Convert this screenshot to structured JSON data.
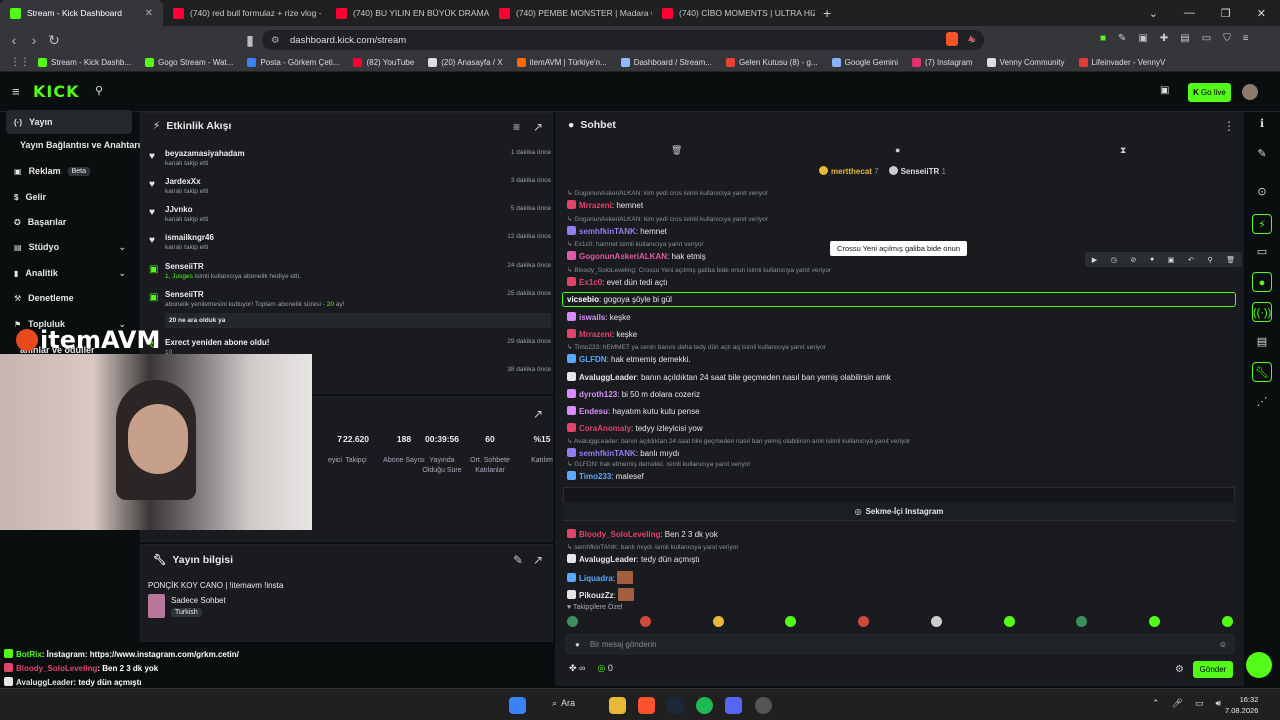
{
  "browser": {
    "tabs": [
      {
        "label": "Stream - Kick Dashboard",
        "color": "#53fc18",
        "active": true
      },
      {
        "label": "(740) red bull formulaz + rize vlog -",
        "color": "#ff0033",
        "active": false
      },
      {
        "label": "(740) BU YILIN EN BÜYÜK DRAMASI",
        "color": "#ff0033",
        "active": false
      },
      {
        "label": "(740) PEMBE MONSTER | Madara Ol",
        "color": "#ff0033",
        "active": false
      },
      {
        "label": "(740) CİBO MOMENTS | ULTRA HIZL",
        "color": "#ff0033",
        "active": false
      }
    ],
    "url": "dashboard.kick.com/stream",
    "bookmarks": [
      {
        "label": "Stream - Kick Dashb...",
        "color": "#53fc18"
      },
      {
        "label": "Gogo Stream - Wat...",
        "color": "#53fc18"
      },
      {
        "label": "Posta - Görkem Çeti...",
        "color": "#3b82f6"
      },
      {
        "label": "(82) YouTube",
        "color": "#ff0033"
      },
      {
        "label": "(20) Anasayfa / X",
        "color": "#dddddd"
      },
      {
        "label": "itemAVM | Türkiye'n...",
        "color": "#ff6a00"
      },
      {
        "label": "Dashboard / Stream...",
        "color": "#8fbcff"
      },
      {
        "label": "Gelen Kutusu (8) - g...",
        "color": "#ea4335"
      },
      {
        "label": "Google Gemini",
        "color": "#8ab4f8"
      },
      {
        "label": "(7) Instagram",
        "color": "#e1306c"
      },
      {
        "label": "Venny Community",
        "color": "#dddddd"
      },
      {
        "label": "Lifeinvader - VennyV",
        "color": "#e53935"
      }
    ]
  },
  "header": {
    "logo": "KICK",
    "go_live": "Go live"
  },
  "sidebar": {
    "items": [
      {
        "label": "Yayın",
        "icon": "broadcast-icon"
      },
      {
        "label": "Yayın Bağlantısı ve Anahtarı",
        "icon": ""
      },
      {
        "label": "Reklam",
        "badge": "Beta",
        "icon": "ad-icon"
      },
      {
        "label": "Gelir",
        "icon": "revenue-icon"
      },
      {
        "label": "Başarılar",
        "icon": "achievement-icon"
      },
      {
        "label": "Stüdyo",
        "icon": "studio-icon"
      },
      {
        "label": "Analitik",
        "icon": "analytics-icon"
      },
      {
        "label": "Denetleme",
        "icon": "moderation-icon"
      },
      {
        "label": "Topluluk",
        "icon": "community-icon"
      },
      {
        "label": "ahınlar ve ödüller",
        "icon": ""
      }
    ]
  },
  "activity": {
    "title": "Etkinlik Akışı",
    "items": [
      {
        "name": "beyazamasiyahadam",
        "sub": "kanalı takip etti",
        "time": "1 dakika önce"
      },
      {
        "name": "JardexXx",
        "sub": "kanalı takip etti",
        "time": "3 dakika önce"
      },
      {
        "name": "JJvnko",
        "sub": "kanalı takip etti",
        "time": "5 dakika önce"
      },
      {
        "name": "ismailkngr46",
        "sub": "kanalı takip etti",
        "time": "12 dakika önce"
      },
      {
        "name": "SenseiiTR",
        "sub_green": "1, Jusges",
        "sub": " isimli kullanıcıya abonelik hediye etti.",
        "time": "24 dakika önce"
      },
      {
        "name": "SenseiiTR",
        "sub": "abonelik yenilemesini kutluyor! Toplam abonelik süresi - ",
        "sub_green": "20",
        "sub_end": " ay!",
        "quote": "20 ne ara olduk ya",
        "time": "25 dakika önce"
      },
      {
        "name": "Exrect yeniden abone oldu!",
        "sub": "10",
        "time": "29 dakika önce"
      },
      {
        "name": "",
        "sub": "üresi - 9 ay!",
        "time": "38 dakika önce"
      }
    ]
  },
  "stats": [
    {
      "value": "7",
      "label": "eyici"
    },
    {
      "value": "22.620",
      "label": "Takipçi"
    },
    {
      "value": "188",
      "label": "Abone Sayısı"
    },
    {
      "value": "00:39:56",
      "label": "Yayında Olduğu Süre"
    },
    {
      "value": "60",
      "label": "Ort. Sohbete Katılanlar"
    },
    {
      "value": "%15",
      "label": "Katılım"
    }
  ],
  "stream_info": {
    "title": "Yayın bilgisi",
    "stream_title": "PONÇİK KOY CANO | !itemavm !insta",
    "category": "Sadece Sohbet",
    "tag": "Turkish"
  },
  "chat": {
    "title": "Sohbet",
    "top_users": [
      {
        "name": "mertthecat",
        "count": "7"
      },
      {
        "name": "SenseiiTR",
        "count": "1"
      }
    ],
    "tooltip": "Crossu Yeni açılmış galiba bide onun",
    "messages": [
      {
        "reply": "GogonunAskeriALKAN: kim yedi cros isimli kullanıcıya yanıt veriyor",
        "user": "Mrrazeni",
        "color": "#e0446a",
        "text": "hemnet"
      },
      {
        "reply": "GogonunAskeriALKAN: kim yedi cros isimli kullanıcıya yanıt veriyor",
        "user": "semhfkinTANK",
        "color": "#8f7ff0",
        "text": "hemnet"
      },
      {
        "reply": "Ex1c0: hamnet isimli kullanıcıya yanıt veriyor",
        "user": "GogonunAskeriALKAN",
        "color": "#e05aa8",
        "text": "hak etmiş"
      },
      {
        "reply": "Bloody_SoloLeveling: Crossu Yeni açılmış galiba bide onun isimli kullanıcıya yanıt veriyor",
        "user": "Ex1c0",
        "color": "#e0446a",
        "text": "evet dün tedi açtı"
      },
      {
        "reply": "",
        "user": "vicsebio",
        "color": "#ffffff",
        "text": "gogoya şöyle bi gül"
      },
      {
        "reply": "",
        "user": "iswails",
        "color": "#d98cff",
        "text": "keşke"
      },
      {
        "reply": "",
        "user": "Mrrazeni",
        "color": "#e0446a",
        "text": "keşke"
      },
      {
        "reply": "Timo233: hEMMET ya senin banını daha tedy dün açtı aq isimli kullanıcıya yanıt veriyor",
        "user": "GLFDN",
        "color": "#5aa8ff",
        "text": "hak etmemiş demekki."
      },
      {
        "reply": "",
        "user": "AvaluggLeader",
        "color": "#e6e6e6",
        "text": "banın açıldıktan 24 saat bile geçmeden nasıl ban yemiş olabilirsin amk"
      },
      {
        "reply": "",
        "user": "dyroth123",
        "color": "#d98cff",
        "text": "bi 50 m dolara cozeriz"
      },
      {
        "reply": "",
        "user": "Endesu",
        "color": "#d98cff",
        "text": "hayatım kutu kutu pense"
      },
      {
        "reply": "",
        "user": "CoraAnomaly",
        "color": "#e0446a",
        "text": "tedyy izleyicisi yow"
      },
      {
        "reply": "AvaluggLeader: banın açıldıktan 24 saat bile geçmeden nasıl ban yemiş olabilirsin amk isimli kullanıcıya yanıt veriyor",
        "user": "semhfkinTANK",
        "color": "#8f7ff0",
        "text": "banlı mıydı"
      },
      {
        "reply": "GLFDN: hak etmemiş demekki. isimli kullanıcıya yanıt veriyor",
        "user": "Timo233",
        "color": "#5aa8ff",
        "text": "malesef"
      },
      {
        "reply": "",
        "user": "BotRix",
        "color": "#53fc18",
        "text": "İnstagram: ",
        "link": "https://www.instagram.com/grkm.cetin/"
      },
      {
        "reply": "",
        "user": "Bloody_SoloLeveling",
        "color": "#e0446a",
        "text": "Ben 2 3 dk yok"
      },
      {
        "reply": "semhfkinTANK: banlı mıydı isimli kullanıcıya yanıt veriyor",
        "user": "AvaluggLeader",
        "color": "#e6e6e6",
        "text": "tedy dün açmıştı"
      },
      {
        "reply": "",
        "user": "Liquadra",
        "color": "#5aa8ff",
        "text": ""
      },
      {
        "reply": "",
        "user": "PikouzZz",
        "color": "#e6e6e6",
        "text": ""
      }
    ],
    "instagram_button": "Sekme-İçi Instagram",
    "followers_only": "Takipçilere Özel",
    "input_placeholder": "Bir mesaj gönderin",
    "send": "Gönder",
    "infinity": "∞",
    "points": "0"
  },
  "overlay": [
    {
      "user": "BotRix",
      "color": "#53fc18",
      "text": ": İnstagram: https://www.instagram.com/grkm.cetin/"
    },
    {
      "user": "Bloody_SoloLeveling",
      "color": "#e0446a",
      "text": ": Ben 2 3 dk yok"
    },
    {
      "user": "AvaluggLeader",
      "color": "#e6e6e6",
      "text": ": tedy dün açmıştı"
    },
    {
      "user": "Liquadra",
      "color": "#5aa8ff",
      "text": ":"
    },
    {
      "user": "PikouzZz",
      "color": "#e6e6e6",
      "text": ":"
    }
  ],
  "webcam_brand": "itemAVM",
  "taskbar": {
    "search": "Ara",
    "time": "16:32",
    "date": "7.08.2026"
  }
}
